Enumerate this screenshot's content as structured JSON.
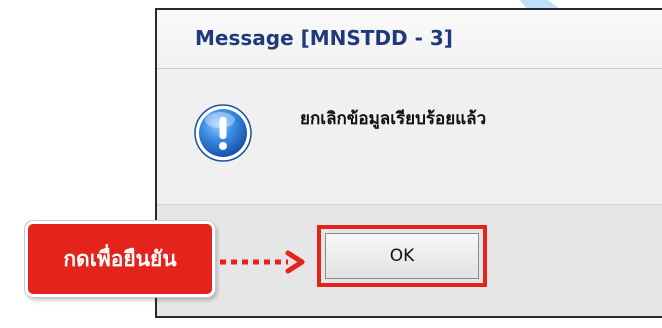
{
  "dialog": {
    "title": "Message [MNSTDD - 3]",
    "message": "ยกเลิกข้อมูลเรียบร้อยแล้ว",
    "icon": "info-icon",
    "ok_label": "OK"
  },
  "callout": {
    "label": "กดเพื่อยืนยัน",
    "color": "#e4231c"
  },
  "colors": {
    "title": "#1f3a7a",
    "highlight": "#e4231c",
    "icon_blue": "#1f67c8"
  }
}
